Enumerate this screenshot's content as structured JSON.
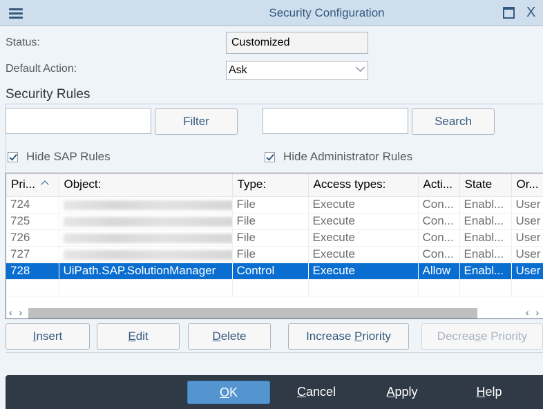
{
  "window": {
    "title": "Security Configuration",
    "menu_icon": "hamburger-menu-icon",
    "maximize_icon": "maximize-icon",
    "close_icon": "close-icon",
    "close_glyph": "X"
  },
  "form": {
    "status_label": "Status:",
    "status_value": "Customized",
    "default_action_label": "Default Action:",
    "default_action_value": "Ask"
  },
  "rules": {
    "section_title": "Security Rules",
    "filter_input_value": "",
    "filter_button": "Filter",
    "search_input_value": "",
    "search_button": "Search",
    "hide_sap_rules_label": "Hide SAP Rules",
    "hide_sap_rules_checked": true,
    "hide_admin_rules_label": "Hide Administrator Rules",
    "hide_admin_rules_checked": true
  },
  "table": {
    "columns": [
      "Pri...",
      "Object:",
      "Type:",
      "Access types:",
      "Acti...",
      "State",
      "Or..."
    ],
    "rows": [
      {
        "priority": "724",
        "object": "",
        "type": "File",
        "access": "Execute",
        "action": "Con...",
        "state": "Enabl...",
        "origin": "User"
      },
      {
        "priority": "725",
        "object": "",
        "type": "File",
        "access": "Execute",
        "action": "Con...",
        "state": "Enabl...",
        "origin": "User"
      },
      {
        "priority": "726",
        "object": "",
        "type": "File",
        "access": "Execute",
        "action": "Con...",
        "state": "Enabl...",
        "origin": "User"
      },
      {
        "priority": "727",
        "object": "",
        "type": "File",
        "access": "Execute",
        "action": "Con...",
        "state": "Enabl...",
        "origin": "User"
      },
      {
        "priority": "728",
        "object": "UiPath.SAP.SolutionManager",
        "type": "Control",
        "access": "Execute",
        "action": "Allow",
        "state": "Enabl...",
        "origin": "User",
        "selected": true
      }
    ],
    "scroll_arrows": "‹ ›"
  },
  "actions": {
    "insert_prefix": "",
    "insert_ul": "I",
    "insert_rest": "nsert",
    "edit_prefix": "",
    "edit_ul": "E",
    "edit_rest": "dit",
    "delete_prefix": "",
    "delete_ul": "D",
    "delete_rest": "elete",
    "increase_prefix": "Increase ",
    "increase_ul": "P",
    "increase_rest": "riority",
    "decrease_prefix": "Decrea",
    "decrease_ul": "s",
    "decrease_rest": "e Priority"
  },
  "footer": {
    "ok_ul": "O",
    "ok_rest": "K",
    "cancel_ul": "C",
    "cancel_rest": "ancel",
    "apply_ul": "A",
    "apply_rest": "pply",
    "help_ul": "H",
    "help_rest": "elp"
  },
  "colors": {
    "titlebar": "#cfdeed",
    "accent": "#34597e",
    "selection": "#0a6ed1",
    "footer": "#2f3a46",
    "primary_button": "#5495d0"
  }
}
